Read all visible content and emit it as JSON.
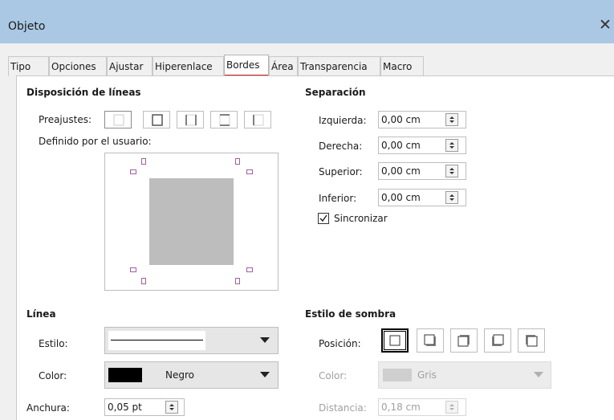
{
  "window": {
    "title": "Objeto",
    "close_glyph": "✕"
  },
  "tabs": [
    {
      "label": "Tipo"
    },
    {
      "label": "Opciones"
    },
    {
      "label": "Ajustar"
    },
    {
      "label": "Hiperenlace"
    },
    {
      "label": "Bordes",
      "active": true
    },
    {
      "label": "Área"
    },
    {
      "label": "Transparencia"
    },
    {
      "label": "Macro"
    }
  ],
  "line_arrangement": {
    "heading": "Disposición de líneas",
    "presets_label": "Preajustes:",
    "user_defined_label": "Definido por el usuario:"
  },
  "spacing": {
    "heading": "Separación",
    "left_label": "Izquierda:",
    "left_value": "0,00 cm",
    "right_label": "Derecha:",
    "right_value": "0,00 cm",
    "top_label": "Superior:",
    "top_value": "0,00 cm",
    "bottom_label": "Inferior:",
    "bottom_value": "0,00 cm",
    "sync_label": "Sincronizar",
    "sync_checked": true
  },
  "line": {
    "heading": "Línea",
    "style_label": "Estilo:",
    "color_label": "Color:",
    "color_value": "Negro",
    "color_swatch": "#000000",
    "width_label": "Anchura:",
    "width_value": "0,05 pt"
  },
  "shadow": {
    "heading": "Estilo de sombra",
    "position_label": "Posición:",
    "color_label": "Color:",
    "color_value": "Gris",
    "color_swatch": "#c8c8c8",
    "distance_label": "Distancia:",
    "distance_value": "0,18 cm"
  },
  "colors": {
    "titlebar": "#aac8e4",
    "active_tab_underline": "#d21f1f",
    "disabled_text": "#a0a0a0"
  }
}
